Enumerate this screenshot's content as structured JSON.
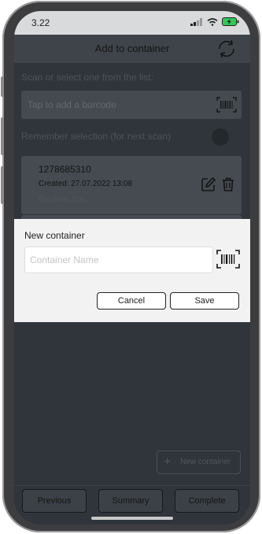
{
  "status_bar": {
    "time": "3.22"
  },
  "nav": {
    "title": "Add to container",
    "refresh_icon": "refresh-icon"
  },
  "scan": {
    "hint": "Scan or select one from the list:",
    "barcode_placeholder": "Tap to add a barcode",
    "remember_label": "Remember selection (for next scan)"
  },
  "containers": [
    {
      "id": "1278685310",
      "created": "Created: 27.07.2022 13:08",
      "by": "By: Jane Doe"
    }
  ],
  "dialog": {
    "title": "New container",
    "name_placeholder": "Container Name",
    "name_value": "",
    "cancel_label": "Cancel",
    "save_label": "Save"
  },
  "actions": {
    "new_container_label": "New container"
  },
  "bottom_bar": {
    "previous_label": "Previous",
    "summary_label": "Summary",
    "complete_label": "Complete"
  },
  "colors": {
    "screen_bg": "#2f353b",
    "dialog_bg": "#f2f2f2",
    "battery_green": "#34c759"
  }
}
